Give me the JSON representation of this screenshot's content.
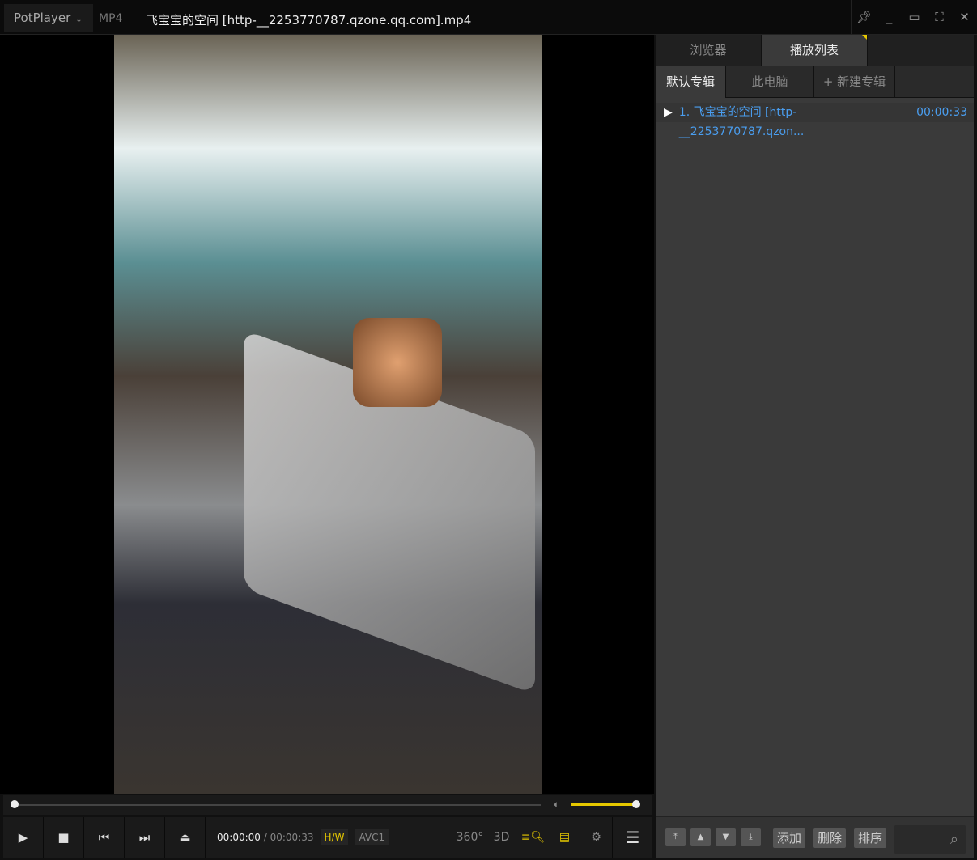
{
  "titlebar": {
    "app": "PotPlayer",
    "format": "MP4",
    "title": "飞宝宝的空间 [http-__2253770787.qzone.qq.com].mp4"
  },
  "controls": {
    "current_time": "00:00:00",
    "separator": "/",
    "duration": "00:00:33",
    "hw": "H/W",
    "codec": "AVC1",
    "badge_360": "360°",
    "badge_3d": "3D",
    "progress_fraction": 0.0,
    "volume_fraction": 1.0
  },
  "panel": {
    "tabs": [
      {
        "label": "浏览器"
      },
      {
        "label": "播放列表"
      }
    ],
    "subtabs": [
      {
        "label": "默认专辑"
      },
      {
        "label": "此电脑"
      },
      {
        "label": "+ 新建专辑"
      }
    ],
    "items": [
      {
        "label": "1. 飞宝宝的空间 [http-__2253770787.qzon...",
        "duration": "00:00:33"
      }
    ],
    "footer": {
      "add": "添加",
      "delete": "删除",
      "sort": "排序"
    }
  },
  "colors": {
    "accent": "#e6c800",
    "link": "#4a9ef0"
  }
}
